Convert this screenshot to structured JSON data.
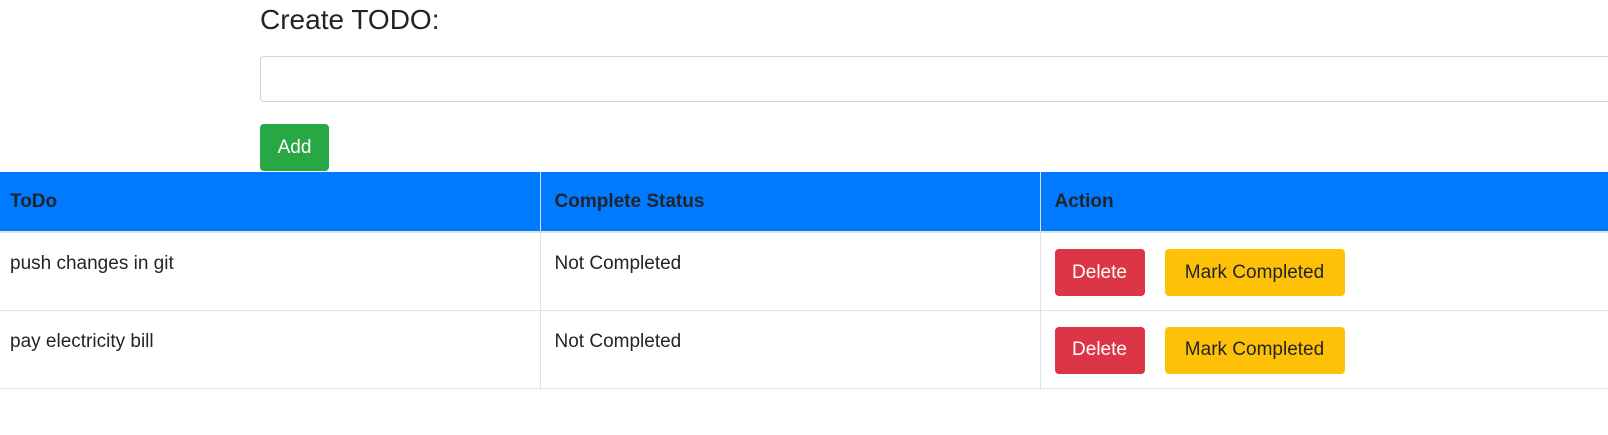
{
  "create": {
    "heading": "Create TODO:",
    "input_value": "",
    "input_placeholder": "",
    "add_label": "Add"
  },
  "table": {
    "headers": [
      "ToDo",
      "Complete Status",
      "Action"
    ],
    "rows": [
      {
        "todo": "push changes in git",
        "status": "Not Completed",
        "delete_label": "Delete",
        "complete_label": "Mark Completed"
      },
      {
        "todo": "pay electricity bill",
        "status": "Not Completed",
        "delete_label": "Delete",
        "complete_label": "Mark Completed"
      }
    ]
  },
  "colors": {
    "header_bg": "#007bff",
    "add_button": "#28a745",
    "delete_button": "#dc3545",
    "complete_button": "#ffc107"
  }
}
